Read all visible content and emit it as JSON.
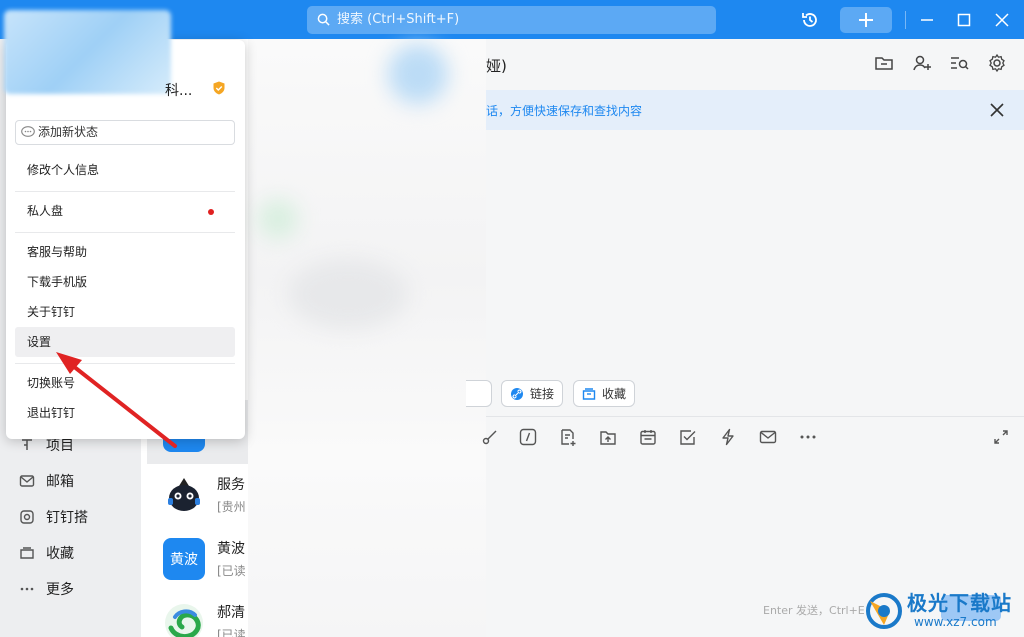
{
  "window": {
    "search_placeholder": "搜索 (Ctrl+Shift+F)",
    "accent": "#1e88f0"
  },
  "nav": {
    "items": [
      {
        "label": "项目",
        "icon": "project-icon"
      },
      {
        "label": "邮箱",
        "icon": "mail-icon"
      },
      {
        "label": "钉钉搭",
        "icon": "dingda-icon"
      },
      {
        "label": "收藏",
        "icon": "favorites-icon"
      },
      {
        "label": "更多",
        "icon": "more-icon"
      }
    ]
  },
  "conversations": [
    {
      "name": "服务",
      "sub": "[贵州",
      "avatar": "robot-avatar"
    },
    {
      "name": "黄波",
      "sub": "[已读",
      "avatar_text": "黄波"
    },
    {
      "name": "郝清",
      "sub": "[已读",
      "avatar": "swirl-avatar"
    }
  ],
  "chat": {
    "title": "娅)",
    "banner_text": "话，方便快速保存和查找内容",
    "chips": [
      "链接",
      "收藏"
    ],
    "send_hint": "Enter 发送，Ctrl+E"
  },
  "popup": {
    "name": "科...",
    "status_placeholder": "添加新状态",
    "items": {
      "edit_profile": "修改个人信息",
      "private_disk": "私人盘",
      "support": "客服与帮助",
      "download_mobile": "下载手机版",
      "about": "关于钉钉",
      "settings": "设置",
      "switch_account": "切换账号",
      "logout": "退出钉钉"
    }
  },
  "watermark": {
    "title": "极光下载站",
    "url": "www.xz7.com"
  }
}
